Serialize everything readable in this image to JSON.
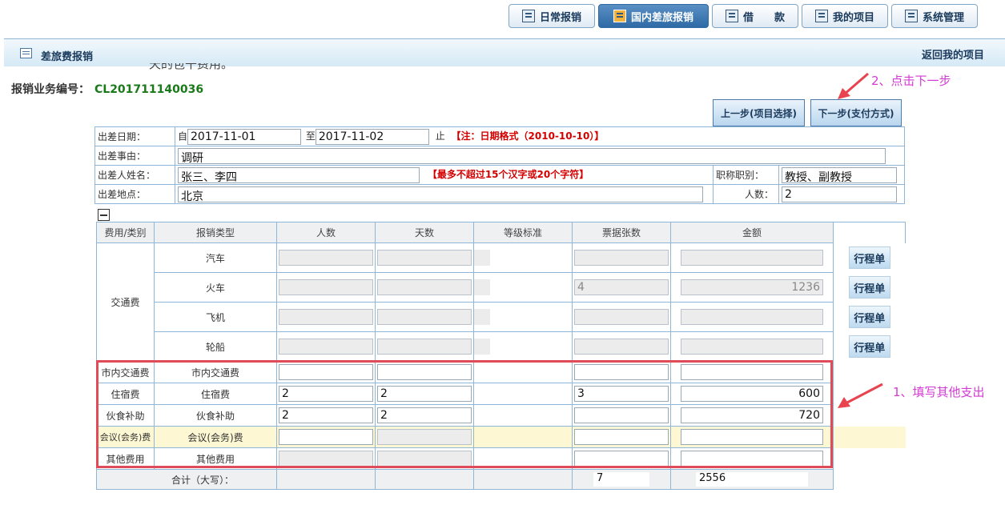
{
  "nav": {
    "tabs": [
      {
        "label": "日常报销",
        "icon": "document-icon",
        "active": false
      },
      {
        "label": "国内差旅报销",
        "icon": "bus-icon",
        "active": true
      },
      {
        "label": "借　　款",
        "icon": "money-icon",
        "active": false
      },
      {
        "label": "我的项目",
        "icon": "list-icon",
        "active": false
      },
      {
        "label": "系统管理",
        "icon": "settings-icon",
        "active": false
      }
    ]
  },
  "header": {
    "title": "差旅费报销",
    "back_link": "返回我的项目"
  },
  "clipped_text": "天的包干费用。",
  "business": {
    "label": "报销业务编号：",
    "number": "CL201711140036"
  },
  "buttons": {
    "prev": "上一步(项目选择)",
    "next": "下一步(支付方式)"
  },
  "annotations": {
    "step2": "2、点击下一步",
    "step1": "1、填写其他支出"
  },
  "form": {
    "date_label": "出差日期：",
    "from_prefix": "自",
    "from_date": "2017-11-01",
    "to_prefix": "至",
    "to_date": "2017-11-02",
    "date_suffix": "止",
    "date_note": "【注：日期格式（2010-10-10）】",
    "reason_label": "出差事由：",
    "reason": "调研",
    "names_label": "出差人姓名：",
    "names": "张三、李四",
    "names_note": "【最多不超过15个汉字或20个字符】",
    "title_label": "职称职别：",
    "title_value": "教授、副教授",
    "place_label": "出差地点：",
    "place": "北京",
    "count_label": "人数：",
    "count": "2"
  },
  "grid": {
    "headers": [
      "费用/类别",
      "报销类型",
      "人数",
      "天数",
      "等级标准",
      "票据张数",
      "金额"
    ],
    "transport_category": "交通费",
    "itinerary_label": "行程单",
    "transport_rows": [
      {
        "type": "汽车",
        "tickets": "",
        "amount": ""
      },
      {
        "type": "火车",
        "tickets": "4",
        "amount": "1236"
      },
      {
        "type": "飞机",
        "tickets": "",
        "amount": ""
      },
      {
        "type": "轮船",
        "tickets": "",
        "amount": ""
      }
    ],
    "other_rows": [
      {
        "category": "市内交通费",
        "type": "市内交通费",
        "people": "",
        "days": "",
        "tickets": "",
        "amount": ""
      },
      {
        "category": "住宿费",
        "type": "住宿费",
        "people": "2",
        "days": "2",
        "tickets": "3",
        "amount": "600"
      },
      {
        "category": "伙食补助",
        "type": "伙食补助",
        "people": "2",
        "days": "2",
        "tickets": "",
        "amount": "720"
      },
      {
        "category": "会议(会务)费",
        "type": "会议(会务)费",
        "people": "",
        "days": "",
        "tickets": "",
        "amount": ""
      },
      {
        "category": "其他费用",
        "type": "其他费用",
        "people": "",
        "days": "",
        "tickets": "",
        "amount": ""
      }
    ],
    "total_label": "合计（大写）：",
    "total_tickets": "7",
    "total_amount": "2556"
  }
}
